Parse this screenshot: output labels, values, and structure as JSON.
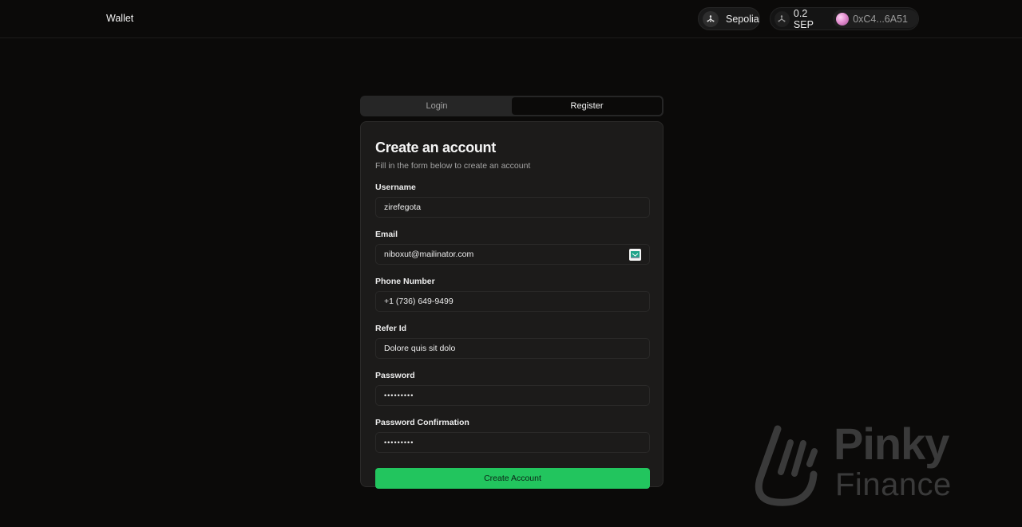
{
  "header": {
    "brand": "Wallet",
    "network": {
      "name": "Sepolia",
      "icon": "network-icon"
    },
    "account": {
      "balance": "0.2 SEP",
      "balance_icon": "network-icon",
      "address": "0xC4...6A51",
      "avatar_colors": [
        "#fbd3f2",
        "#e48fd0",
        "#a24e95"
      ]
    }
  },
  "tabs": [
    {
      "label": "Login",
      "active": false
    },
    {
      "label": "Register",
      "active": true
    }
  ],
  "form": {
    "title": "Create an account",
    "subtitle": "Fill in the form below to create an account",
    "fields": [
      {
        "label": "Username",
        "value": "zirefegota",
        "type": "text"
      },
      {
        "label": "Email",
        "value": "niboxut@mailinator.com",
        "type": "email",
        "extension_icon": "email-extension-icon"
      },
      {
        "label": "Phone Number",
        "value": "+1 (736) 649-9499",
        "type": "tel"
      },
      {
        "label": "Refer Id",
        "value": "Dolore quis sit dolo",
        "type": "text"
      },
      {
        "label": "Password",
        "value": "•••••••••",
        "type": "password"
      },
      {
        "label": "Password Confirmation",
        "value": "•••••••••",
        "type": "password"
      }
    ],
    "submit_label": "Create Account"
  },
  "watermark": {
    "line1": "Pinky",
    "line2": "Finance"
  },
  "colors": {
    "background": "#0b0a09",
    "card": "#1c1b1a",
    "accent": "#22c55e",
    "muted_text": "#a3a3a3"
  }
}
